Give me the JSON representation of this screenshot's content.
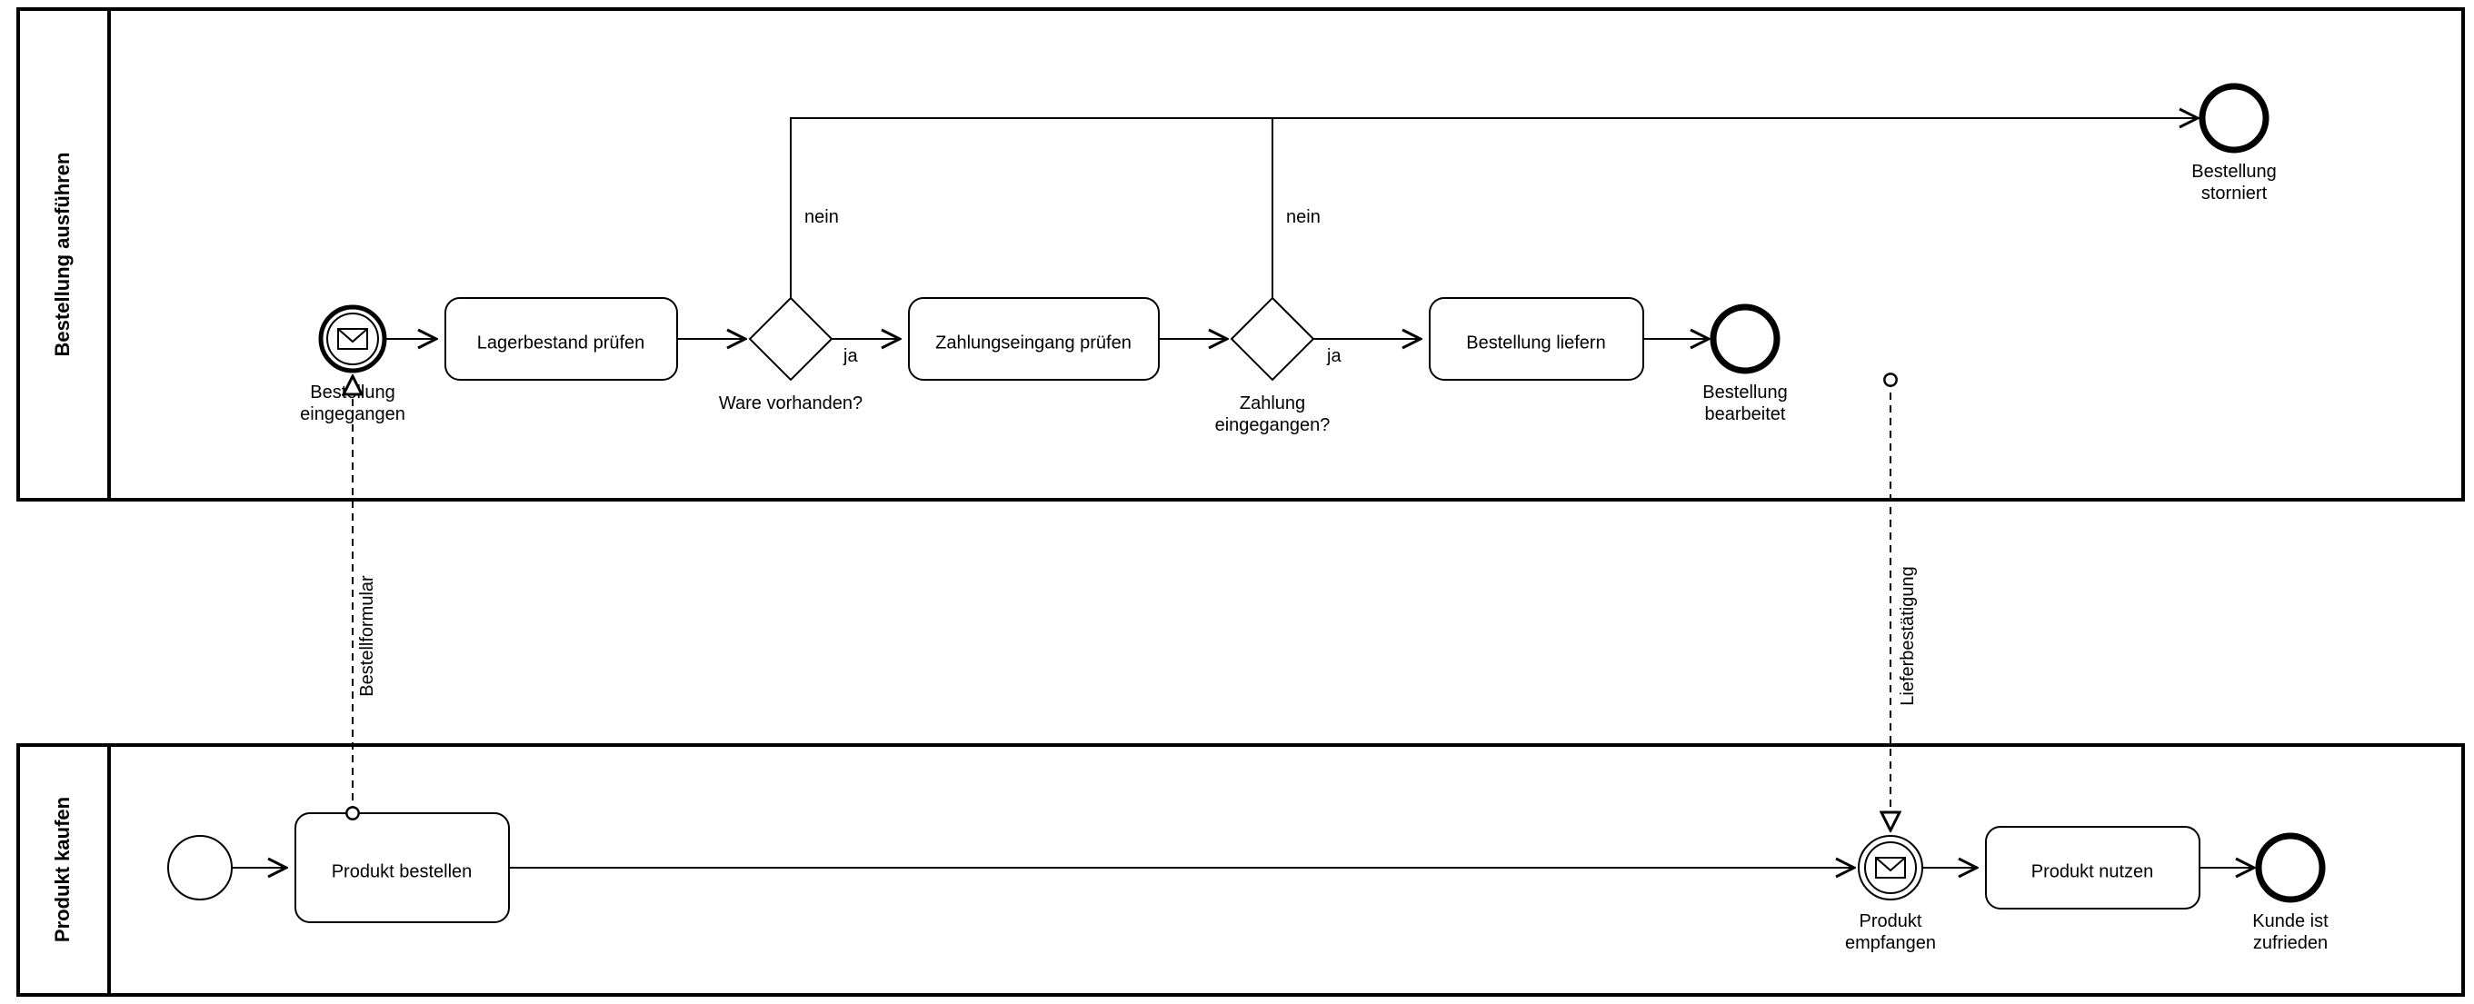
{
  "pools": {
    "top": {
      "title": "Bestellung ausführen"
    },
    "bottom": {
      "title": "Produkt kaufen"
    }
  },
  "top": {
    "startEvent": {
      "label1": "Bestellung",
      "label2": "eingegangen"
    },
    "task1": "Lagerbestand prüfen",
    "gateway1": {
      "label": "Ware vorhanden?",
      "yes": "ja",
      "no": "nein"
    },
    "task2": "Zahlungseingang prüfen",
    "gateway2": {
      "label1": "Zahlung",
      "label2": "eingegangen?",
      "yes": "ja",
      "no": "nein"
    },
    "task3": "Bestellung liefern",
    "end1": {
      "label1": "Bestellung",
      "label2": "storniert"
    },
    "end2": {
      "label1": "Bestellung",
      "label2": "bearbeitet"
    }
  },
  "bottom": {
    "task1": "Produkt bestellen",
    "interEvent": {
      "label1": "Produkt",
      "label2": "empfangen"
    },
    "task2": "Produkt nutzen",
    "end": {
      "label1": "Kunde ist",
      "label2": "zufrieden"
    }
  },
  "messages": {
    "m1": "Bestellformular",
    "m2": "Lieferbestätigung"
  }
}
